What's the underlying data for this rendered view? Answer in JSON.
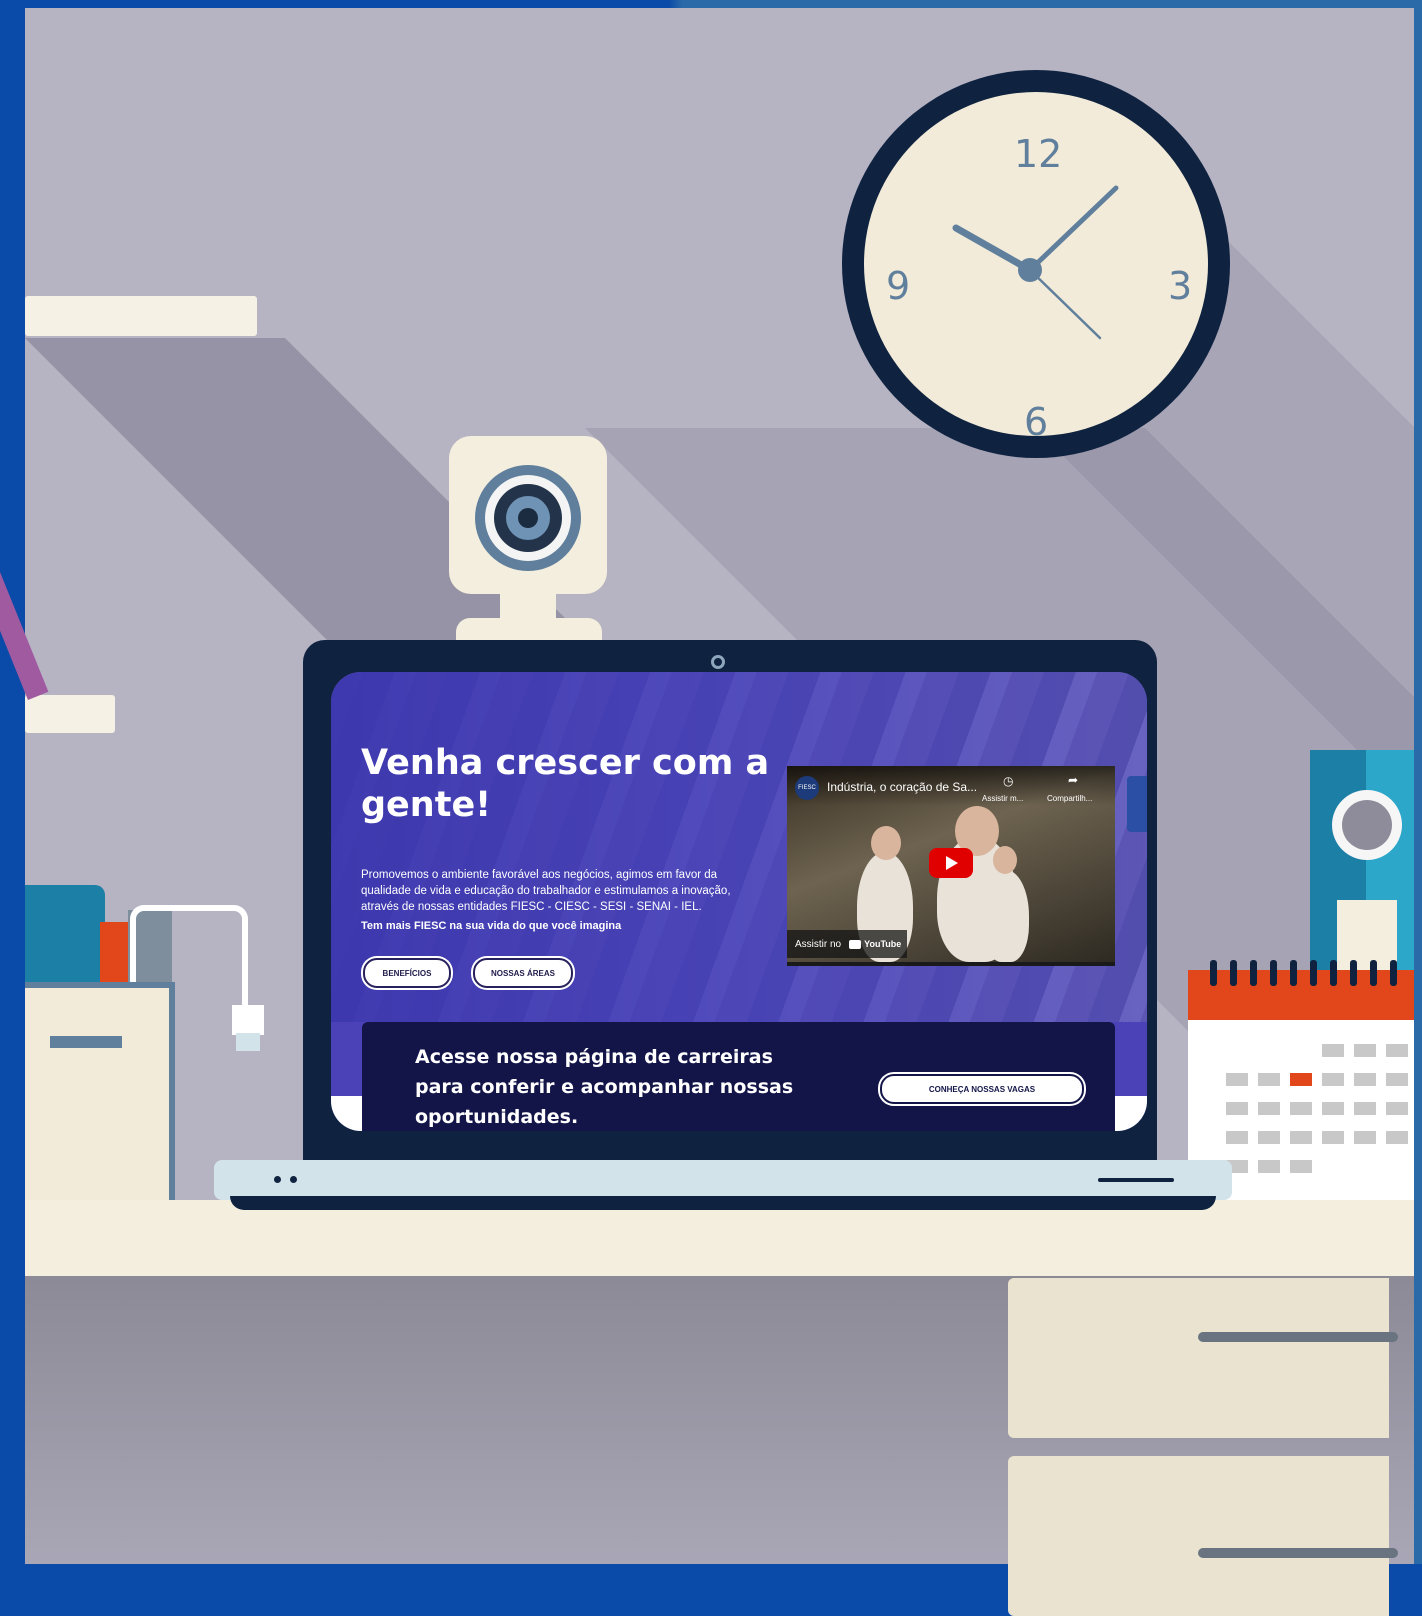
{
  "clock": {
    "numbers": {
      "twelve": "12",
      "three": "3",
      "six": "6",
      "nine": "9"
    },
    "colors": {
      "face": "#f2ebd9",
      "rim": "#0f2340",
      "hands": "#5f7f9c"
    }
  },
  "site": {
    "hero_title": "Venha crescer com a gente!",
    "hero_description": "Promovemos o ambiente favorável aos negócios, agimos em favor da qualidade de vida e educação do trabalhador e estimulamos a inovação, através de nossas entidades FIESC - CIESC - SESI - SENAI - IEL.",
    "hero_tagline": "Tem mais FIESC na sua vida do que você imagina",
    "buttons": {
      "benefits": "BENEFÍCIOS",
      "areas": "NOSSAS ÁREAS"
    },
    "video": {
      "channel_logo": "FIESC",
      "title": "Indústria, o coração de Sa...",
      "watch_later": "Assistir m...",
      "share": "Compartilh...",
      "watch_on": "Assistir no",
      "platform": "YouTube",
      "icons": [
        "clock-icon",
        "share-icon",
        "play-icon"
      ]
    },
    "careers": {
      "text": "Acesse nossa página de carreiras para conferir e acompanhar nossas oportunidades.",
      "button": "CONHEÇA NOSSAS VAGAS"
    },
    "colors": {
      "hero": "#4a42b6",
      "card": "#131548",
      "play": "#e00000"
    }
  },
  "scene": {
    "colors": {
      "wall": "#b6b3c3",
      "frame": "#0a4aa8",
      "desk": "#f3eedd",
      "calendar_accent": "#e2461b",
      "binder": "#2ca6c9"
    }
  }
}
